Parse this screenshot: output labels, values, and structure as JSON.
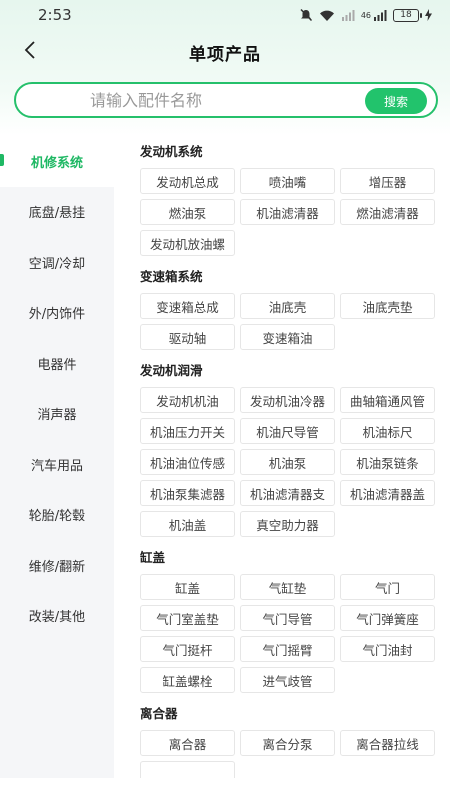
{
  "status_bar": {
    "time": "2:53",
    "network": "46",
    "battery": "18"
  },
  "header": {
    "title": "单项产品"
  },
  "search": {
    "placeholder": "请输入配件名称",
    "button_label": "搜索"
  },
  "sidebar": {
    "items": [
      {
        "label": "机修系统",
        "active": true
      },
      {
        "label": "底盘/悬挂",
        "active": false
      },
      {
        "label": "空调/冷却",
        "active": false
      },
      {
        "label": "外/内饰件",
        "active": false
      },
      {
        "label": "电器件",
        "active": false
      },
      {
        "label": "消声器",
        "active": false
      },
      {
        "label": "汽车用品",
        "active": false
      },
      {
        "label": "轮胎/轮毂",
        "active": false
      },
      {
        "label": "维修/翻新",
        "active": false
      },
      {
        "label": "改装/其他",
        "active": false
      }
    ]
  },
  "sections": [
    {
      "title": "发动机系统",
      "items": [
        "发动机总成",
        "喷油嘴",
        "增压器",
        "燃油泵",
        "机油滤清器",
        "燃油滤清器",
        "发动机放油螺"
      ]
    },
    {
      "title": "变速箱系统",
      "items": [
        "变速箱总成",
        "油底壳",
        "油底壳垫",
        "驱动轴",
        "变速箱油"
      ]
    },
    {
      "title": "发动机润滑",
      "items": [
        "发动机机油",
        "发动机油冷器",
        "曲轴箱通风管",
        "机油压力开关",
        "机油尺导管",
        "机油标尺",
        "机油油位传感",
        "机油泵",
        "机油泵链条",
        "机油泵集滤器",
        "机油滤清器支",
        "机油滤清器盖",
        "机油盖",
        "真空助力器"
      ]
    },
    {
      "title": "缸盖",
      "items": [
        "缸盖",
        "气缸垫",
        "气门",
        "气门室盖垫",
        "气门导管",
        "气门弹簧座",
        "气门挺杆",
        "气门摇臂",
        "气门油封",
        "缸盖螺栓",
        "进气歧管"
      ]
    },
    {
      "title": "离合器",
      "items": [
        "离合器",
        "离合分泵",
        "离合器拉线"
      ]
    }
  ],
  "colors": {
    "accent": "#22c36c",
    "sidebar_bg": "#f5f6f8"
  }
}
